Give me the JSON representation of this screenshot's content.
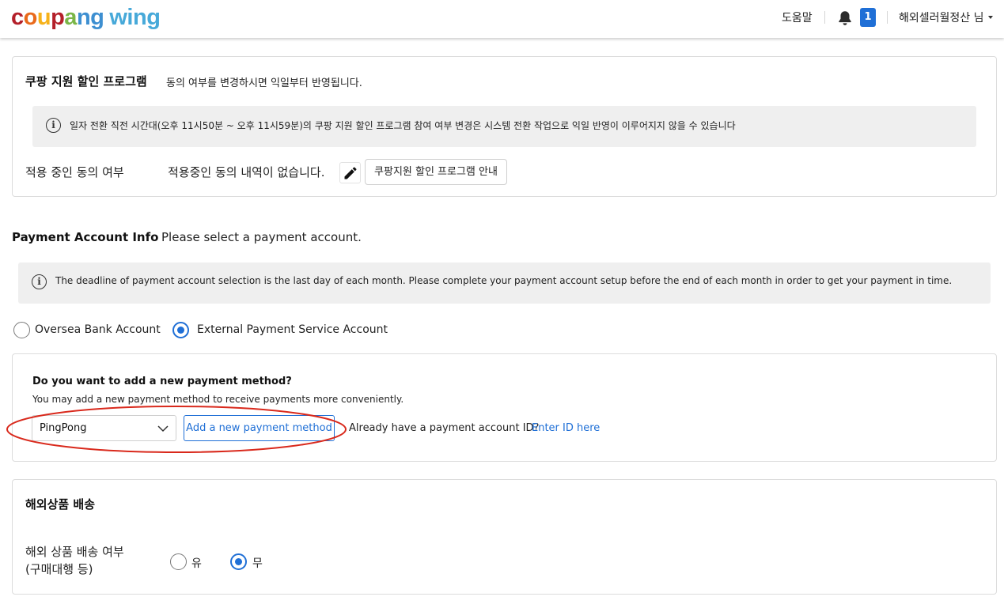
{
  "header": {
    "logo_letters": [
      "c",
      "o",
      "u",
      "p",
      "a",
      "n",
      "g"
    ],
    "logo_wing": "wing",
    "help": "도움말",
    "notification_count": "1",
    "user": "해외셀러월정산 님"
  },
  "discount_program": {
    "title": "쿠팡 지원 할인 프로그램",
    "description": "동의 여부를 변경하시면 익일부터 반영됩니다.",
    "notice": "일자 전환 직전 시간대(오후 11시50분 ~ 오후 11시59분)의 쿠팡 지원 할인 프로그램 참여 여부 변경은 시스템 전환 작업으로 익일 반영이 이루어지지 않을 수 있습니다",
    "consent_label": "적용 중인 동의 여부",
    "consent_value": "적용중인 동의 내역이 없습니다.",
    "guide_button": "쿠팡지원 할인 프로그램 안내"
  },
  "payment": {
    "title": "Payment Account Info",
    "subtitle": "Please select a payment account.",
    "notice": "The deadline of payment account selection is the last day of each month. Please complete your payment account setup before the end of each month in order to get your payment in time.",
    "options": [
      {
        "label": "Oversea Bank Account",
        "selected": false
      },
      {
        "label": "External Payment Service Account",
        "selected": true
      }
    ],
    "add_method": {
      "question": "Do you want to add a new payment method?",
      "description": "You may add a new payment method to receive payments more conveniently.",
      "selected_provider": "PingPong",
      "add_button": "Add a new payment method",
      "already_text": "Already have a payment account ID?",
      "enter_link": "Enter ID here"
    },
    "highlight_color": "#d9291c"
  },
  "overseas_shipping": {
    "title": "해외상품 배송",
    "label_line1": "해외 상품 배송 여부",
    "label_line2": "(구매대행 등)",
    "options": [
      {
        "label": "유",
        "selected": false
      },
      {
        "label": "무",
        "selected": true
      }
    ]
  },
  "colors": {
    "accent": "#1f6fd6",
    "info_background": "#efefef"
  }
}
